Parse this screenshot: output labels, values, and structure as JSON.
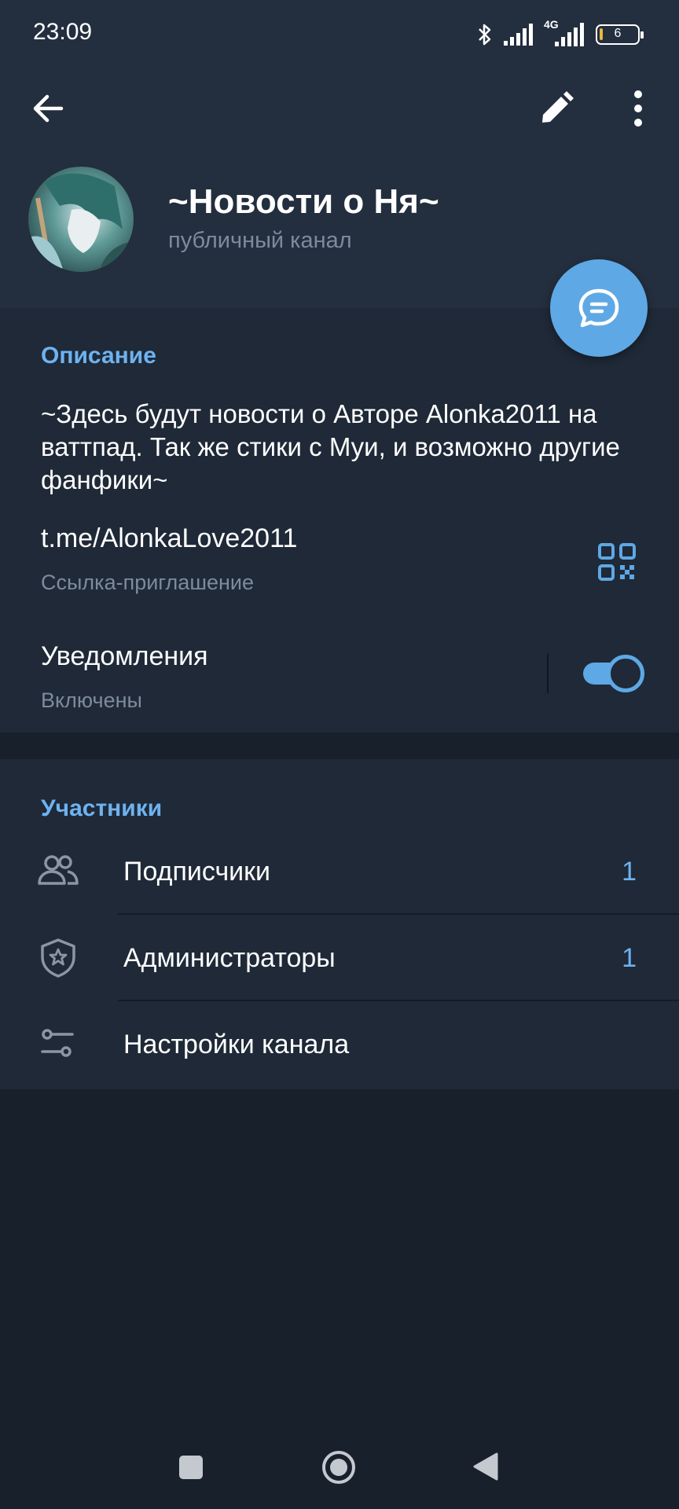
{
  "status_bar": {
    "time": "23:09",
    "network": "4G",
    "battery": "6"
  },
  "toolbar": {
    "back_icon": "arrow-left-icon",
    "edit_icon": "pencil-icon",
    "more_icon": "more-vertical-icon"
  },
  "channel": {
    "title": "~Новости о Ня~",
    "subtitle": "публичный канал"
  },
  "info": {
    "section_title": "Описание",
    "description": "~Здесь будут новости о Авторе Alonka2011 на ваттпад. Так же стики с Муи, и возможно другие фанфики~",
    "link": "t.me/AlonkaLove2011",
    "link_caption": "Ссылка-приглашение",
    "notifications_title": "Уведомления",
    "notifications_status": "Включены",
    "notifications_enabled": true
  },
  "members": {
    "section_title": "Участники",
    "items": [
      {
        "label": "Подписчики",
        "count": "1",
        "icon": "users-icon"
      },
      {
        "label": "Администраторы",
        "count": "1",
        "icon": "shield-star-icon"
      },
      {
        "label": "Настройки канала",
        "count": "",
        "icon": "sliders-icon"
      }
    ]
  },
  "colors": {
    "accent": "#5ea8e5",
    "header_bg": "#232e3e",
    "section_bg": "#1f2937",
    "page_bg": "#18202c"
  }
}
